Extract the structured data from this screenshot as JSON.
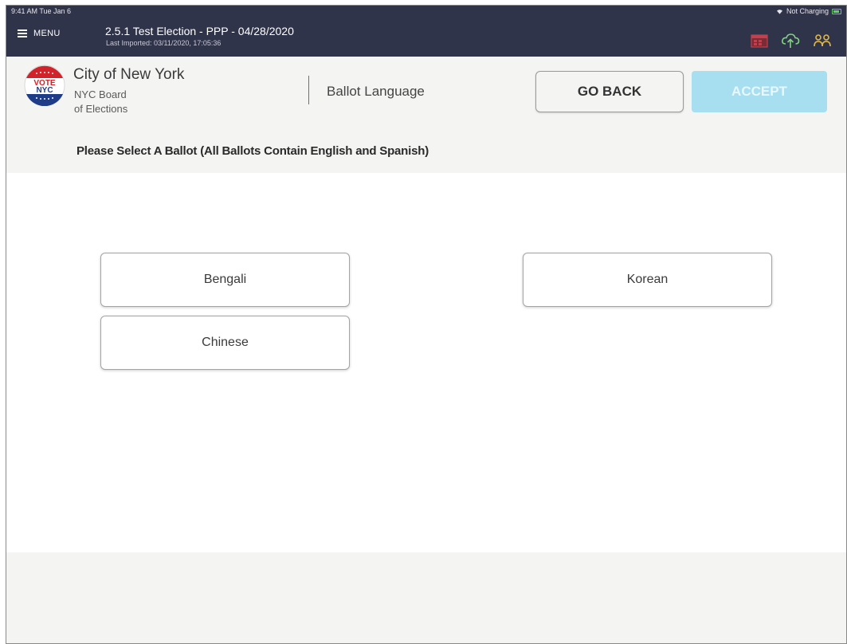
{
  "status_bar": {
    "time": "9:41 AM  Tue Jan 6",
    "charging": "Not Charging"
  },
  "app_bar": {
    "menu_label": "MENU",
    "election_title": "2.5.1 Test Election - PPP - 04/28/2020",
    "last_imported": "Last Imported: 03/11/2020, 17:05:36",
    "icons": [
      "calendar-icon",
      "cloud-upload-icon",
      "users-icon"
    ]
  },
  "header": {
    "logo_text_top": "VOTE",
    "logo_text_bottom": "NYC",
    "org_name": "City of New York",
    "org_sub1": "NYC Board",
    "org_sub2": "of Elections",
    "screen_title": "Ballot Language",
    "go_back_label": "GO BACK",
    "accept_label": "ACCEPT"
  },
  "instruction": "Please Select A Ballot (All Ballots Contain English and Spanish)",
  "languages": [
    {
      "label": "Bengali"
    },
    {
      "label": "Korean"
    },
    {
      "label": "Chinese"
    }
  ],
  "colors": {
    "app_bar": "#30344a",
    "accept_disabled": "#a8dff0",
    "divider": "#c84a4a",
    "background": "#f4f4f2"
  }
}
